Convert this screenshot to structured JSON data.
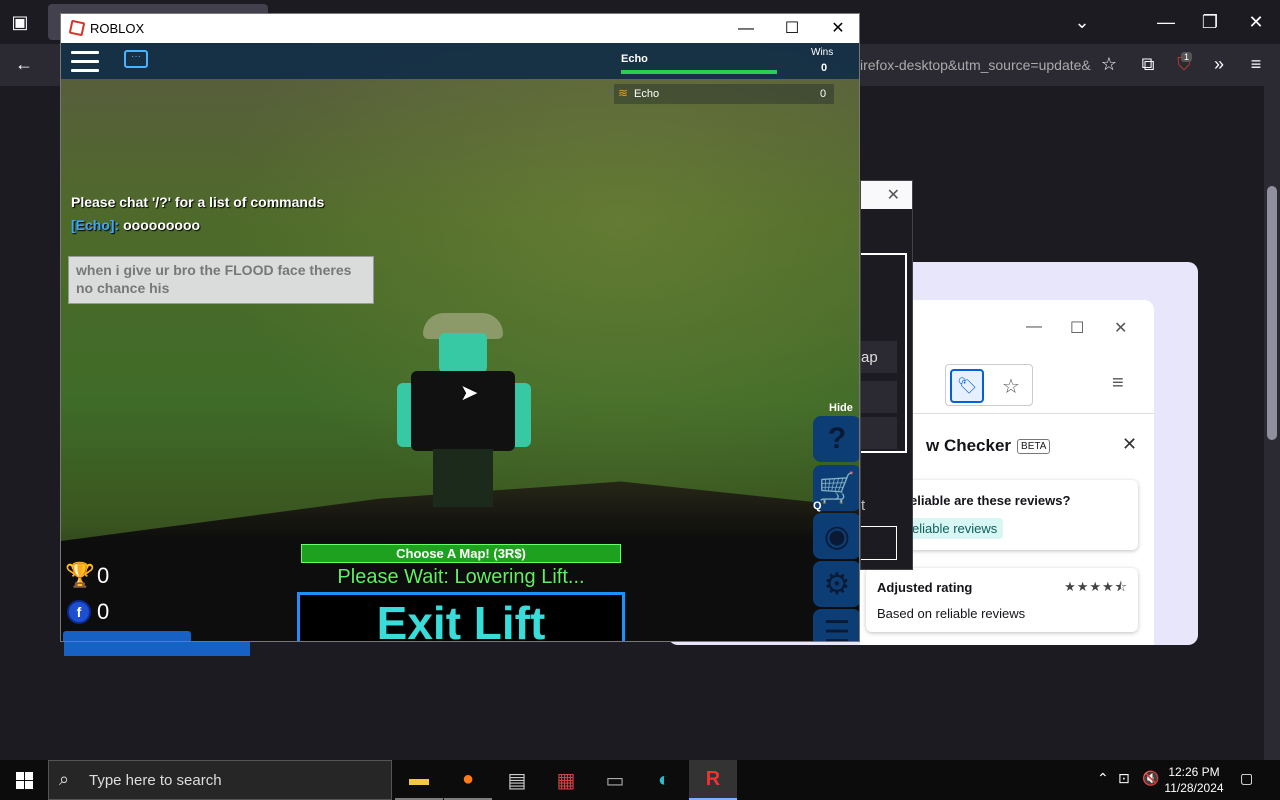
{
  "firefox": {
    "url_fragment": "irefox-desktop&utm_source=update&",
    "toolbar_icons": [
      "back-arrow-icon",
      "star-icon",
      "extensions-icon",
      "ublock-icon",
      "overflow-icon",
      "hamburger-menu-icon"
    ],
    "ublock_badge": "1"
  },
  "dialog": {
    "partial_text_1": "ap",
    "partial_text_2": "t"
  },
  "review_checker": {
    "title": "w Checker",
    "beta": "BETA",
    "question": "eliable are these reviews?",
    "pill": "eliable reviews",
    "adjusted_rating_label": "Adjusted rating",
    "stars": "★★★★⯪",
    "based_on": "Based on reliable reviews"
  },
  "roblox": {
    "window_title": "ROBLOX",
    "leaderboard": {
      "header_name": "Echo",
      "wins_label": "Wins",
      "wins_value": "0",
      "player_name": "Echo",
      "player_value": "0"
    },
    "chat": {
      "system_message": "Please chat '/?' for a list of commands",
      "sender": "[Echo]:",
      "message": "ooooooooo",
      "input_text": "when i give ur bro the FLOOD face theres no chance his"
    },
    "side_buttons": {
      "hide_label": "Hide",
      "q_label": "Q",
      "help_glyph": "?"
    },
    "choose_map": "Choose A Map! (3R$)",
    "wait_message": "Please Wait: Lowering Lift...",
    "exit_lift": "Exit Lift",
    "trophies": "0",
    "coins": "0",
    "coin_glyph": "f"
  },
  "taskbar": {
    "search_placeholder": "Type here to search",
    "time": "12:26 PM",
    "date": "11/28/2024",
    "apps": [
      "file-explorer-icon",
      "firefox-icon",
      "photos-icon",
      "winrar-icon",
      "terminal-icon",
      "edge-icon",
      "roblox-icon"
    ]
  }
}
